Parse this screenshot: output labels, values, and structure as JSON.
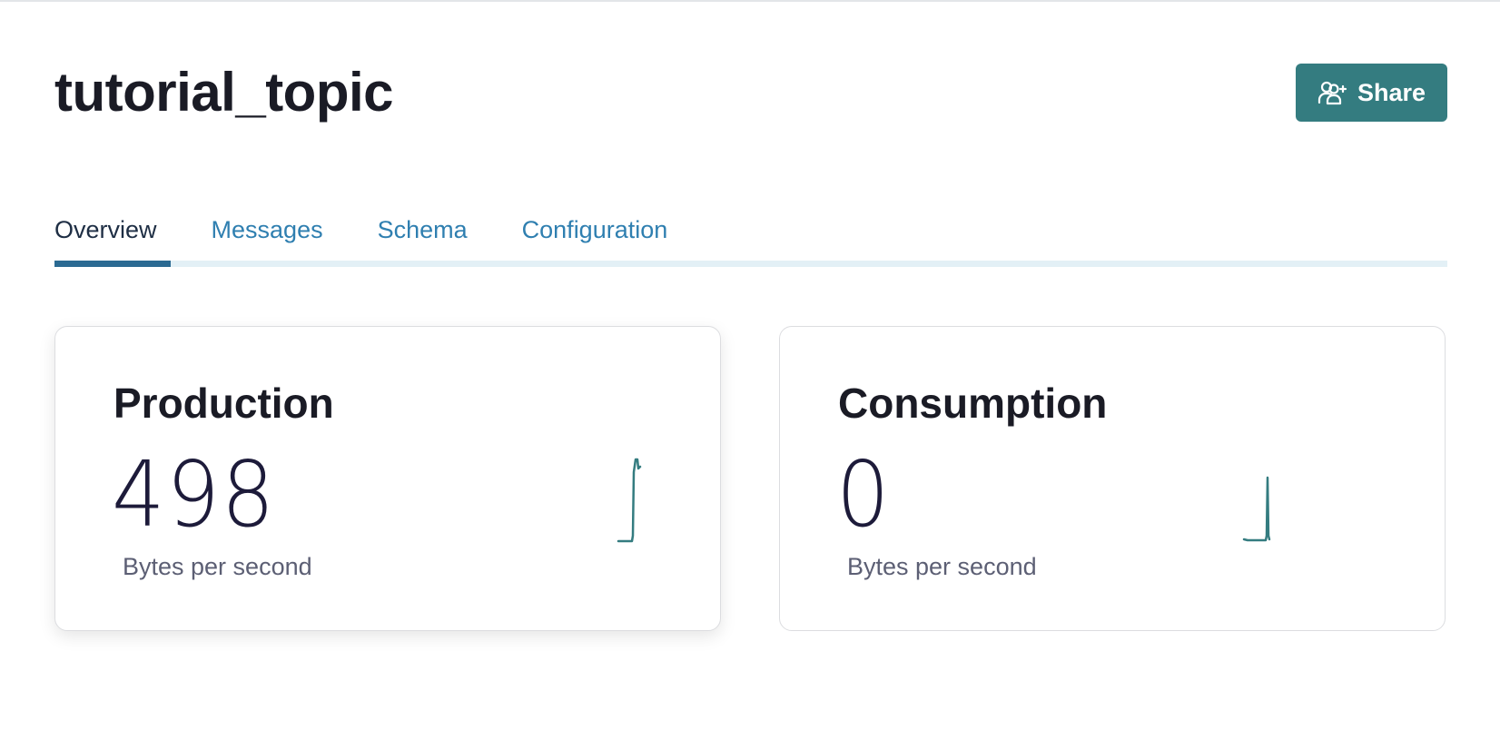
{
  "topic": {
    "title": "tutorial_topic"
  },
  "header": {
    "share_label": "Share",
    "share_icon": "add-users-icon"
  },
  "tabs": [
    {
      "label": "Overview",
      "active": true
    },
    {
      "label": "Messages",
      "active": false
    },
    {
      "label": "Schema",
      "active": false
    },
    {
      "label": "Configuration",
      "active": false
    }
  ],
  "metrics": {
    "production": {
      "title": "Production",
      "value": "498",
      "unit": "Bytes per second"
    },
    "consumption": {
      "title": "Consumption",
      "value": "0",
      "unit": "Bytes per second"
    }
  },
  "colors": {
    "accent": "#347c80",
    "tab_active": "#1e2e44",
    "tab_inactive": "#2f7fb0",
    "tab_indicator": "#2b6a92",
    "sparkline": "#347c80"
  }
}
